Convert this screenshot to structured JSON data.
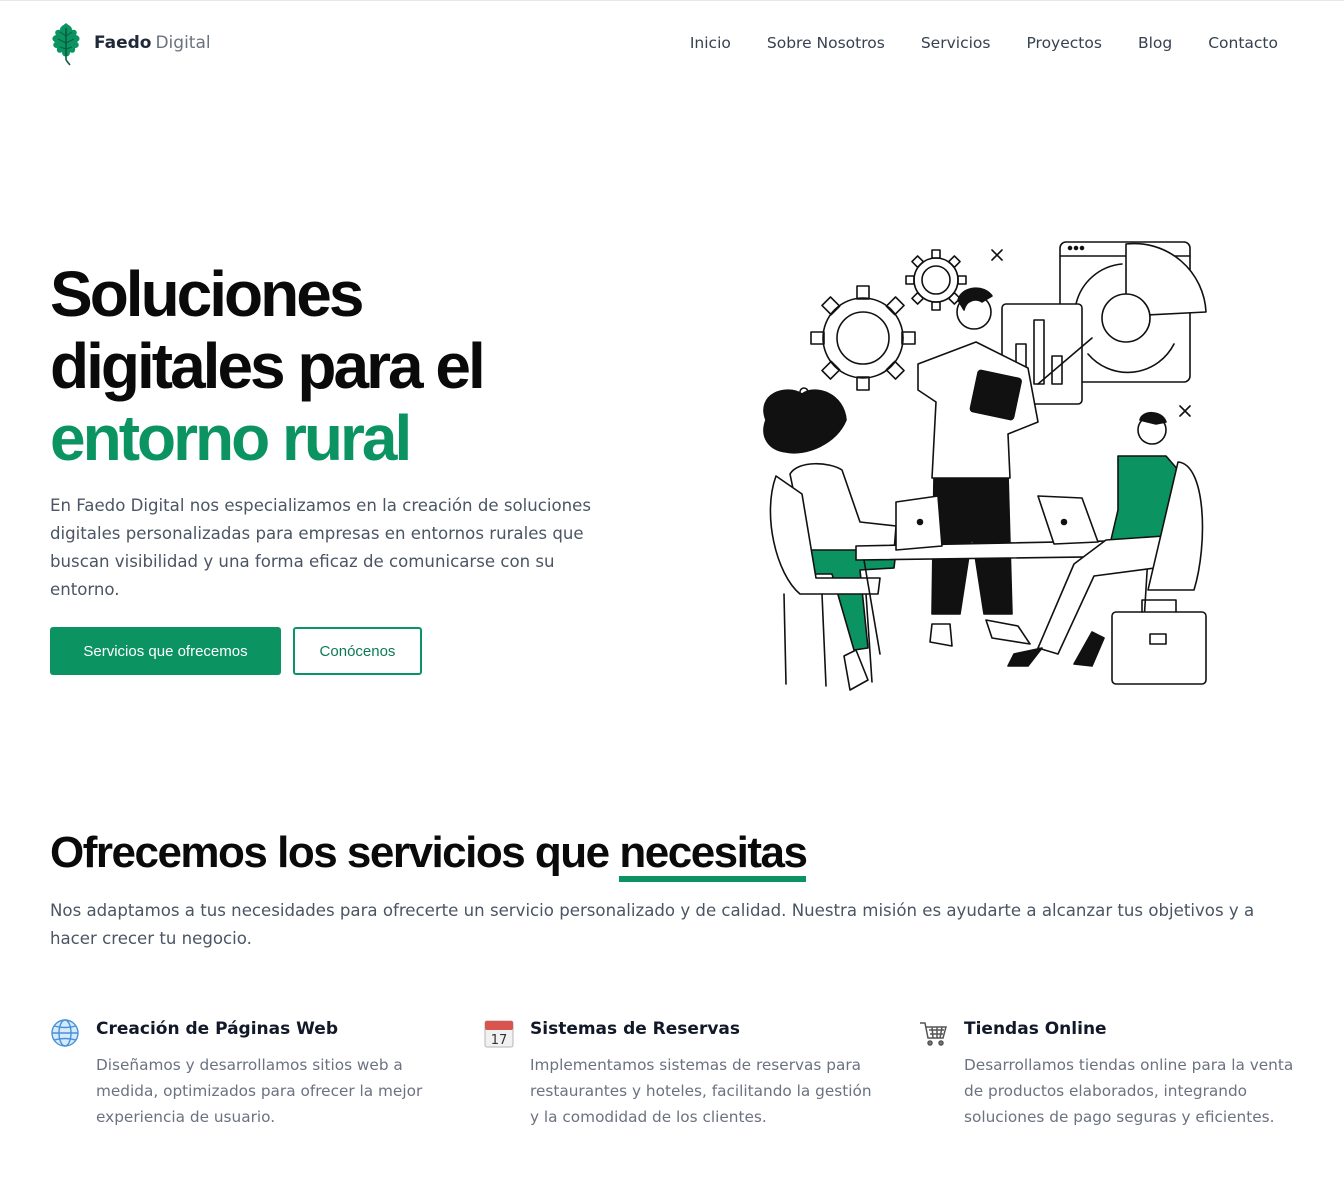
{
  "brand": {
    "name_bold": "Faedo",
    "name_light": "Digital",
    "logo_icon": "oak-leaf-icon",
    "color": "#0b9462"
  },
  "nav": {
    "items": [
      "Inicio",
      "Sobre Nosotros",
      "Servicios",
      "Proyectos",
      "Blog",
      "Contacto"
    ]
  },
  "hero": {
    "title_line1": "Soluciones",
    "title_line2": "digitales para el",
    "title_line3": "entorno rural",
    "description": "En Faedo Digital nos especializamos en la creación de soluciones digitales personalizadas para empresas en entornos rurales que buscan visibilidad y una forma eficaz de comunicarse con su entorno.",
    "primary_button": "Servicios que ofrecemos",
    "secondary_button": "Conócenos",
    "illustration": "team-working-illustration"
  },
  "services": {
    "title_main": "Ofrecemos los servicios que ",
    "title_highlight": "necesitas",
    "description": "Nos adaptamos a tus necesidades para ofrecerte un servicio personalizado y de calidad. Nuestra misión es ayudarte a alcanzar tus objetivos y a hacer crecer tu negocio.",
    "items": [
      {
        "icon": "globe-icon",
        "title": "Creación de Páginas Web",
        "text": "Diseñamos y desarrollamos sitios web a medida, optimizados para ofrecer la mejor experiencia de usuario."
      },
      {
        "icon": "calendar-icon",
        "title": "Sistemas de Reservas",
        "text": "Implementamos sistemas de reservas para restaurantes y hoteles, facilitando la gestión y la comodidad de los clientes."
      },
      {
        "icon": "shopping-cart-icon",
        "title": "Tiendas Online",
        "text": "Desarrollamos tiendas online para la venta de productos elaborados, integrando soluciones de pago seguras y eficientes."
      }
    ],
    "calendar_day": "17"
  },
  "colors": {
    "accent": "#0b9462",
    "text": "#0a0a0a",
    "muted": "#4b5563"
  }
}
